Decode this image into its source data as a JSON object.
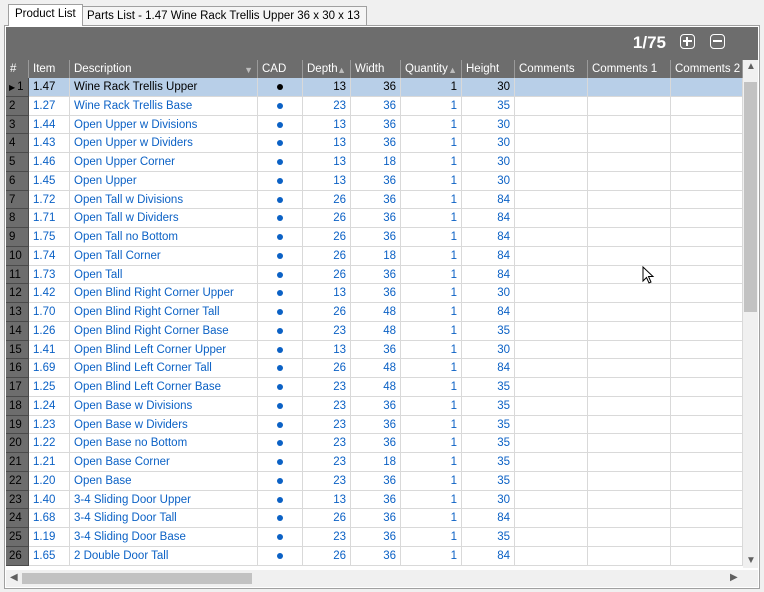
{
  "tabs": [
    {
      "label": "Product List",
      "active": true
    },
    {
      "label": "Parts List - 1.47 Wine Rack Trellis Upper 36 x 30 x 13",
      "active": false
    }
  ],
  "pager": {
    "text": "1/75"
  },
  "columns": {
    "num": "#",
    "item": "Item",
    "description": "Description",
    "cad": "CAD",
    "depth": "Depth",
    "width": "Width",
    "quantity": "Quantity",
    "height": "Height",
    "comments": "Comments",
    "comments1": "Comments 1",
    "comments2": "Comments 2"
  },
  "rows": [
    {
      "n": "1",
      "item": "1.47",
      "desc": "Wine Rack Trellis Upper",
      "depth": "13",
      "width": "36",
      "qty": "1",
      "height": "30",
      "selected": true
    },
    {
      "n": "2",
      "item": "1.27",
      "desc": "Wine Rack Trellis Base",
      "depth": "23",
      "width": "36",
      "qty": "1",
      "height": "35"
    },
    {
      "n": "3",
      "item": "1.44",
      "desc": "Open Upper w Divisions",
      "depth": "13",
      "width": "36",
      "qty": "1",
      "height": "30"
    },
    {
      "n": "4",
      "item": "1.43",
      "desc": "Open Upper w Dividers",
      "depth": "13",
      "width": "36",
      "qty": "1",
      "height": "30"
    },
    {
      "n": "5",
      "item": "1.46",
      "desc": "Open Upper Corner",
      "depth": "13",
      "width": "18",
      "qty": "1",
      "height": "30"
    },
    {
      "n": "6",
      "item": "1.45",
      "desc": "Open Upper",
      "depth": "13",
      "width": "36",
      "qty": "1",
      "height": "30"
    },
    {
      "n": "7",
      "item": "1.72",
      "desc": "Open Tall w Divisions",
      "depth": "26",
      "width": "36",
      "qty": "1",
      "height": "84"
    },
    {
      "n": "8",
      "item": "1.71",
      "desc": "Open Tall w Dividers",
      "depth": "26",
      "width": "36",
      "qty": "1",
      "height": "84"
    },
    {
      "n": "9",
      "item": "1.75",
      "desc": "Open Tall no Bottom",
      "depth": "26",
      "width": "36",
      "qty": "1",
      "height": "84"
    },
    {
      "n": "10",
      "item": "1.74",
      "desc": "Open Tall Corner",
      "depth": "26",
      "width": "18",
      "qty": "1",
      "height": "84"
    },
    {
      "n": "11",
      "item": "1.73",
      "desc": "Open Tall",
      "depth": "26",
      "width": "36",
      "qty": "1",
      "height": "84"
    },
    {
      "n": "12",
      "item": "1.42",
      "desc": "Open Blind Right Corner Upper",
      "depth": "13",
      "width": "36",
      "qty": "1",
      "height": "30"
    },
    {
      "n": "13",
      "item": "1.70",
      "desc": "Open Blind Right Corner Tall",
      "depth": "26",
      "width": "48",
      "qty": "1",
      "height": "84"
    },
    {
      "n": "14",
      "item": "1.26",
      "desc": "Open Blind Right Corner Base",
      "depth": "23",
      "width": "48",
      "qty": "1",
      "height": "35"
    },
    {
      "n": "15",
      "item": "1.41",
      "desc": "Open Blind Left Corner Upper",
      "depth": "13",
      "width": "36",
      "qty": "1",
      "height": "30"
    },
    {
      "n": "16",
      "item": "1.69",
      "desc": "Open Blind Left Corner Tall",
      "depth": "26",
      "width": "48",
      "qty": "1",
      "height": "84"
    },
    {
      "n": "17",
      "item": "1.25",
      "desc": "Open Blind Left Corner Base",
      "depth": "23",
      "width": "48",
      "qty": "1",
      "height": "35"
    },
    {
      "n": "18",
      "item": "1.24",
      "desc": "Open Base w Divisions",
      "depth": "23",
      "width": "36",
      "qty": "1",
      "height": "35"
    },
    {
      "n": "19",
      "item": "1.23",
      "desc": "Open Base w Dividers",
      "depth": "23",
      "width": "36",
      "qty": "1",
      "height": "35"
    },
    {
      "n": "20",
      "item": "1.22",
      "desc": "Open Base no Bottom",
      "depth": "23",
      "width": "36",
      "qty": "1",
      "height": "35"
    },
    {
      "n": "21",
      "item": "1.21",
      "desc": "Open Base Corner",
      "depth": "23",
      "width": "18",
      "qty": "1",
      "height": "35"
    },
    {
      "n": "22",
      "item": "1.20",
      "desc": "Open Base",
      "depth": "23",
      "width": "36",
      "qty": "1",
      "height": "35"
    },
    {
      "n": "23",
      "item": "1.40",
      "desc": "3-4 Sliding Door Upper",
      "depth": "13",
      "width": "36",
      "qty": "1",
      "height": "30"
    },
    {
      "n": "24",
      "item": "1.68",
      "desc": "3-4 Sliding Door Tall",
      "depth": "26",
      "width": "36",
      "qty": "1",
      "height": "84"
    },
    {
      "n": "25",
      "item": "1.19",
      "desc": "3-4 Sliding Door Base",
      "depth": "23",
      "width": "36",
      "qty": "1",
      "height": "35"
    },
    {
      "n": "26",
      "item": "1.65",
      "desc": "2 Double Door Tall",
      "depth": "26",
      "width": "36",
      "qty": "1",
      "height": "84"
    }
  ],
  "colors": {
    "header": "#6d6d6d",
    "link": "#0b61c5",
    "selected": "#b8cfe8"
  },
  "icons": {
    "add": "plus-square-icon",
    "remove": "minus-square-icon",
    "row_pointer": "triangle-right-icon"
  }
}
